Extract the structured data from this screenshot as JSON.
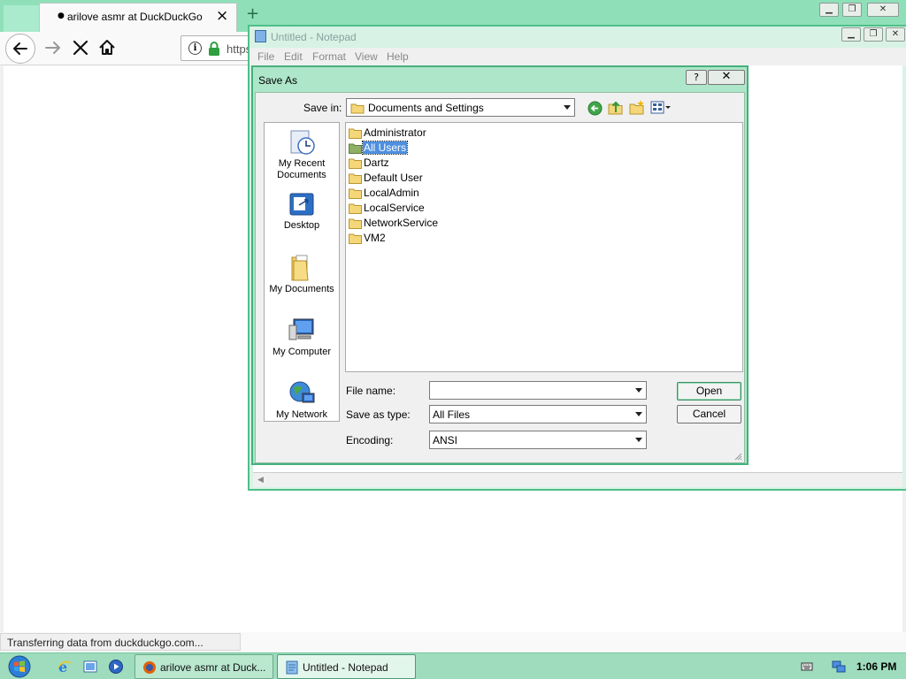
{
  "browser": {
    "tab_title": "arilove asmr at DuckDuckGo",
    "tab_close": "×",
    "new_tab": "+",
    "url_prefix": "https:",
    "status_text": "Transferring data from duckduckgo.com..."
  },
  "notepad": {
    "title": "Untitled - Notepad",
    "menu": [
      "File",
      "Edit",
      "Format",
      "View",
      "Help"
    ]
  },
  "save_as": {
    "title": "Save As",
    "help_label": "?",
    "save_in_label": "Save in:",
    "save_in_value": "Documents and Settings",
    "places": [
      {
        "label_line1": "My Recent",
        "label_line2": "Documents"
      },
      {
        "label_line1": "Desktop",
        "label_line2": ""
      },
      {
        "label_line1": "My Documents",
        "label_line2": ""
      },
      {
        "label_line1": "My Computer",
        "label_line2": ""
      },
      {
        "label_line1": "My Network",
        "label_line2": ""
      }
    ],
    "folders": [
      {
        "name": "Administrator",
        "selected": false
      },
      {
        "name": "All Users",
        "selected": true
      },
      {
        "name": "Dartz",
        "selected": false
      },
      {
        "name": "Default User",
        "selected": false
      },
      {
        "name": "LocalAdmin",
        "selected": false
      },
      {
        "name": "LocalService",
        "selected": false
      },
      {
        "name": "NetworkService",
        "selected": false
      },
      {
        "name": "VM2",
        "selected": false
      }
    ],
    "file_name_label": "File name:",
    "file_name_value": "",
    "save_as_type_label": "Save as type:",
    "save_as_type_value": "All Files",
    "encoding_label": "Encoding:",
    "encoding_value": "ANSI",
    "open_label": "Open",
    "cancel_label": "Cancel"
  },
  "taskbar": {
    "tasks": [
      {
        "label": "arilove asmr at Duck...",
        "active": false
      },
      {
        "label": "Untitled - Notepad",
        "active": true
      }
    ],
    "clock": "1:06 PM"
  },
  "colors": {
    "window_frame": "#44b17d",
    "titlebar": "#aee6c9",
    "taskbar": "#9fdcbd",
    "selection": "#4d8fe0",
    "secure_lock": "#2e9e3e"
  }
}
